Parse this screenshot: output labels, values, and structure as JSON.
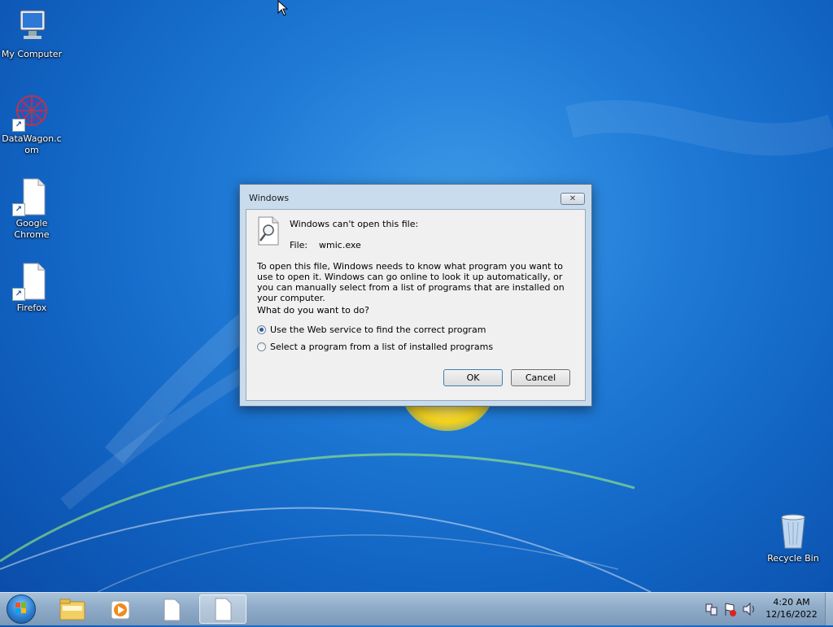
{
  "desktop": {
    "icons": [
      {
        "label": "My Computer"
      },
      {
        "label": "DataWagon.c\nom"
      },
      {
        "label": "Google\nChrome"
      },
      {
        "label": "Firefox"
      },
      {
        "label": "Recycle Bin"
      }
    ]
  },
  "dialog": {
    "title": "Windows",
    "headline": "Windows can't open this file:",
    "file_label": "File:",
    "file_value": "wmic.exe",
    "paragraph": "To open this file, Windows needs to know what program you want to use to open it. Windows can go online to look it up automatically, or you can manually select from a list of programs that are installed on your computer.",
    "question": "What do you want to do?",
    "options": [
      {
        "label": "Use the Web service to find the correct program",
        "checked": true
      },
      {
        "label": "Select a program from a list of installed programs",
        "checked": false
      }
    ],
    "ok_label": "OK",
    "cancel_label": "Cancel"
  },
  "taskbar": {
    "pinned": [
      "start-button",
      "windows-explorer",
      "media-player",
      "blank-document",
      "blank-document-active"
    ],
    "clock_time": "4:20 AM",
    "clock_date": "12/16/2022"
  },
  "colors": {
    "desktop_blue": "#1f7ad6",
    "dialog_frame": "#c9dcee",
    "taskbar": "#8fabc8"
  }
}
